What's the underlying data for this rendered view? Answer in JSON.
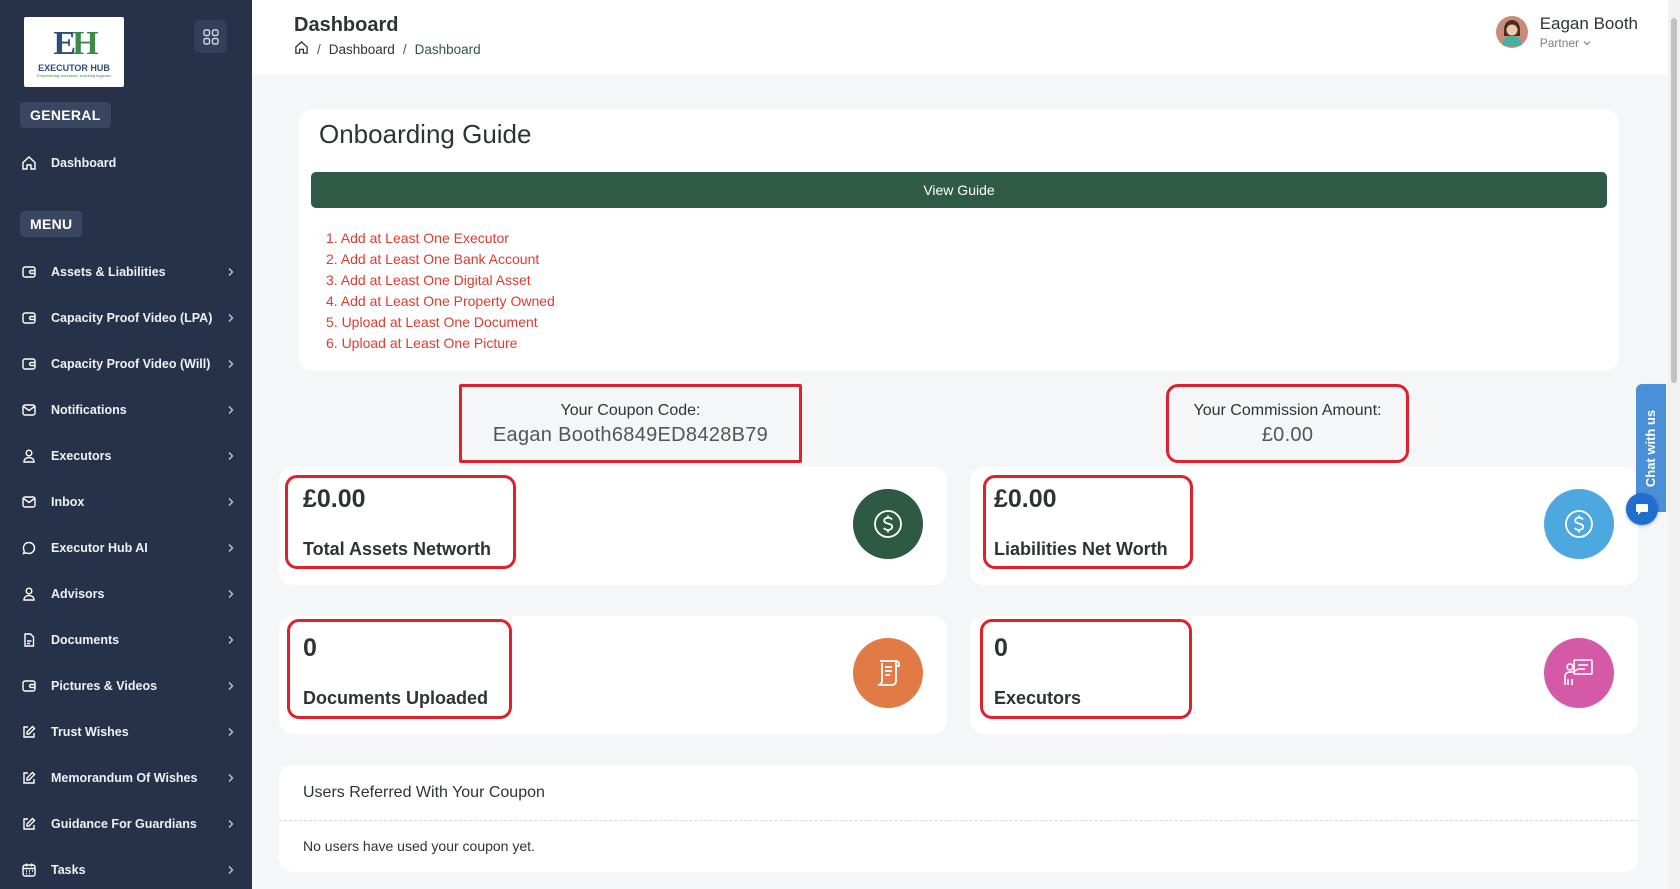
{
  "brand": {
    "logo_mark": "EH",
    "name": "EXECUTOR HUB",
    "tagline": "Empowering executors, ensuring legacies"
  },
  "sidebar": {
    "general_label": "GENERAL",
    "dashboard_label": "Dashboard",
    "menu_label": "MENU",
    "items": [
      {
        "label": "Assets & Liabilities",
        "icon": "wallet-icon"
      },
      {
        "label": "Capacity Proof Video (LPA)",
        "icon": "wallet-icon"
      },
      {
        "label": "Capacity Proof Video (Will)",
        "icon": "wallet-icon"
      },
      {
        "label": "Notifications",
        "icon": "mail-icon"
      },
      {
        "label": "Executors",
        "icon": "user-icon"
      },
      {
        "label": "Inbox",
        "icon": "mail-icon"
      },
      {
        "label": "Executor Hub AI",
        "icon": "chat-icon"
      },
      {
        "label": "Advisors",
        "icon": "user-icon"
      },
      {
        "label": "Documents",
        "icon": "document-icon"
      },
      {
        "label": "Pictures & Videos",
        "icon": "wallet-icon"
      },
      {
        "label": "Trust Wishes",
        "icon": "edit-icon"
      },
      {
        "label": "Memorandum Of Wishes",
        "icon": "edit-icon"
      },
      {
        "label": "Guidance For Guardians",
        "icon": "edit-icon"
      },
      {
        "label": "Tasks",
        "icon": "calendar-icon"
      }
    ]
  },
  "header": {
    "title": "Dashboard",
    "breadcrumb": [
      "Dashboard",
      "Dashboard"
    ],
    "user_name": "Eagan Booth",
    "user_role": "Partner"
  },
  "onboarding": {
    "title": "Onboarding Guide",
    "button_label": "View Guide",
    "steps": [
      "1. Add at Least One Executor",
      "2. Add at Least One Bank Account",
      "3. Add at Least One Digital Asset",
      "4. Add at Least One Property Owned",
      "5. Upload at Least One Document",
      "6. Upload at Least One Picture"
    ]
  },
  "coupon": {
    "label": "Your Coupon Code:",
    "value": "Eagan Booth6849ED8428B79"
  },
  "commission": {
    "label": "Your Commission Amount:",
    "value": "£0.00"
  },
  "stats": [
    {
      "value": "£0.00",
      "label": "Total Assets Networth",
      "icon": "dollar-icon",
      "color": "#2e5a44"
    },
    {
      "value": "£0.00",
      "label": "Liabilities Net Worth",
      "icon": "dollar-icon",
      "color": "#4ea8e0"
    },
    {
      "value": "0",
      "label": "Documents Uploaded",
      "icon": "receipt-icon",
      "color": "#e27a45"
    },
    {
      "value": "0",
      "label": "Executors",
      "icon": "presenter-icon",
      "color": "#d45aa8"
    }
  ],
  "referred": {
    "title": "Users Referred With Your Coupon",
    "empty_text": "No users have used your coupon yet."
  },
  "chat": {
    "label": "Chat with us"
  },
  "colors": {
    "sidebar_bg": "#27324a",
    "primary_green": "#2f5a45",
    "alert_red": "#e23a2e",
    "highlight_red": "#e0202b"
  }
}
